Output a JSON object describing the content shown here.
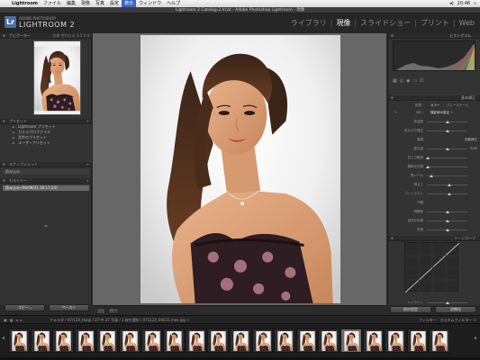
{
  "menubar": {
    "items": [
      "Lightroom",
      "ファイル",
      "編集",
      "現像",
      "写真",
      "設定",
      "表示",
      "ウィンドウ",
      "ヘルプ"
    ],
    "selected_index": 6,
    "time": "20:46"
  },
  "window": {
    "title": "Lightroom 2 Catalog-2.lrcat - Adobe Photoshop Lightroom - 現像"
  },
  "identity": {
    "logo": "Lr",
    "sub": "ADOBE PHOTOSHOP",
    "name": "LIGHTROOM 2"
  },
  "modules": {
    "items": [
      "ライブラリ",
      "現像",
      "スライドショー",
      "プリント",
      "Web"
    ],
    "active_index": 1
  },
  "left": {
    "navigator": {
      "title": "ナビゲーター",
      "zoom": "全体  合わせる  1:1  1:4"
    },
    "presets": {
      "title": "プリセット",
      "items": [
        "Lightroom プリセット",
        "カメラプロファイル",
        "文件のプリセット",
        "ユーザープリセット"
      ]
    },
    "snapshots": {
      "title": "スナップショット",
      "items": [
        "読み込み"
      ]
    },
    "history": {
      "title": "ヒストリー",
      "items": [
        "読み込み (06/08/31 16:17:24)"
      ]
    },
    "buttons": {
      "copy": "コピー...",
      "paste": "ペースト"
    }
  },
  "right": {
    "histogram": {
      "title": "ヒストグラム"
    },
    "basic": {
      "title": "基本補正",
      "treatment_label": "処理 :",
      "treatment": [
        "カラー",
        "グレースケール"
      ],
      "wb_label": "WB :",
      "wb_value": "撮影時の設定 ÷",
      "rows": [
        {
          "label": "色温度",
          "pos": 50
        },
        {
          "label": "色かぶり補正",
          "pos": 50
        },
        {
          "label": "階調",
          "value": "自動補正"
        },
        {
          "label": "露光量",
          "pos": 50,
          "value": "0.00"
        },
        {
          "label": "白とび軽減",
          "pos": 3
        },
        {
          "label": "補助光効果",
          "pos": 3
        },
        {
          "label": "黒レベル",
          "pos": 12
        },
        {
          "label": "明るさ",
          "pos": 55
        },
        {
          "label": "コントラスト",
          "pos": 55
        },
        {
          "label": "外観",
          "value": ""
        },
        {
          "label": "明瞭度",
          "pos": 50
        },
        {
          "label": "自然な彩度",
          "pos": 50
        },
        {
          "label": "彩度",
          "pos": 50
        }
      ]
    },
    "tone": {
      "title": "トーンカーブ",
      "labels": [
        "ハイライト",
        "ライト",
        "ダーク",
        "シャドウ"
      ],
      "point_curve": "ポイントカーブ :",
      "point_value": "リニア ÷"
    },
    "buttons": {
      "prev": "前の設定",
      "reset": "初期化"
    }
  },
  "toolbar": {
    "label": "YY ÷"
  },
  "filmstrip": {
    "info": "フォルダ / 07/124_Holgi / 27 中 27 写真 / 1 枚を選択 / 071124_00031.mos.jpg ÷",
    "filter_label": "フィルター :",
    "filter_value": "カスタムフィルター ÷",
    "count": 20,
    "selected_index": 15
  }
}
